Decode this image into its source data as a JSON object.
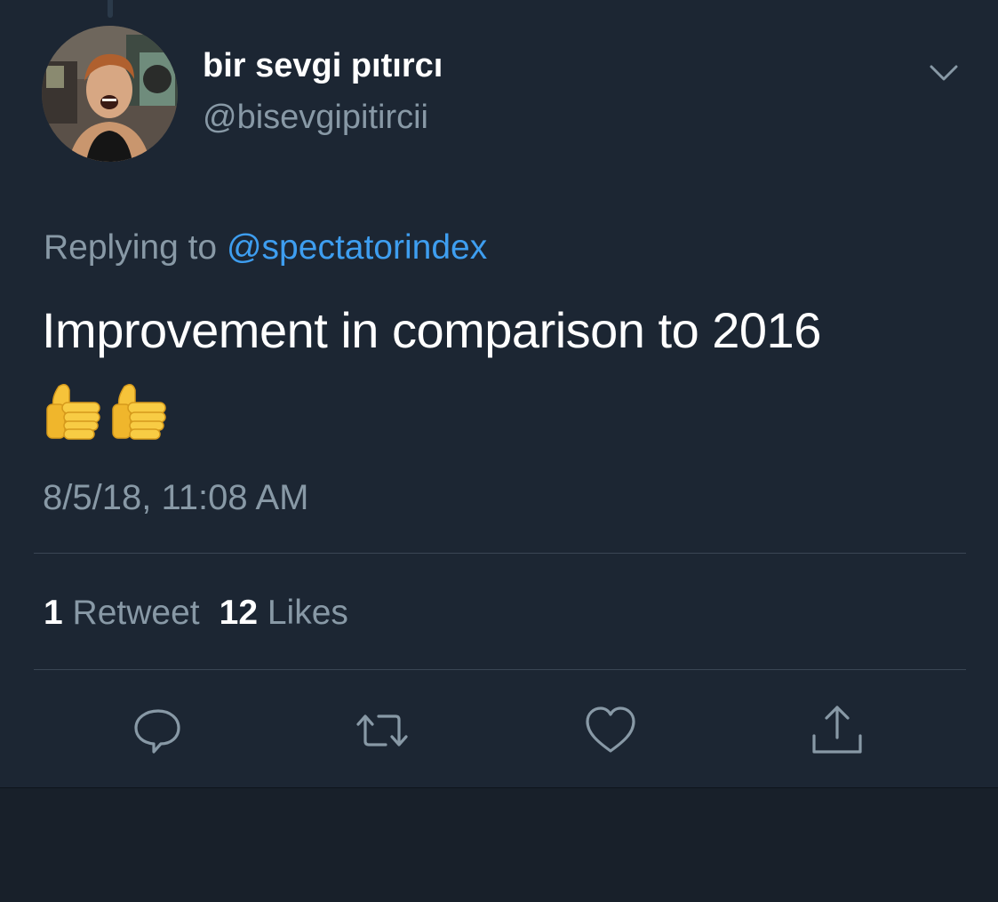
{
  "tweet": {
    "author": {
      "display_name": "bir sevgi pıtırcı",
      "handle": "@bisevgipitircii",
      "avatar": "user-avatar-photo"
    },
    "reply": {
      "prefix": "Replying to",
      "target": "@spectatorindex"
    },
    "text": "Improvement in comparison to 2016",
    "emojis": [
      "thumbs-up",
      "thumbs-up"
    ],
    "timestamp": "8/5/18, 11:08 AM",
    "stats": {
      "retweets_count": "1",
      "retweets_label": "Retweet",
      "likes_count": "12",
      "likes_label": "Likes"
    },
    "actions": [
      {
        "name": "reply",
        "icon": "speech-bubble-icon"
      },
      {
        "name": "retweet",
        "icon": "retweet-icon"
      },
      {
        "name": "like",
        "icon": "heart-icon"
      },
      {
        "name": "share",
        "icon": "share-icon"
      }
    ],
    "menu_icon": "chevron-down-icon"
  },
  "colors": {
    "background": "#1c2633",
    "text_primary": "#ffffff",
    "text_secondary": "#8899a6",
    "link": "#3e9ef0",
    "divider": "#3a4654",
    "icon": "#8899a6"
  }
}
